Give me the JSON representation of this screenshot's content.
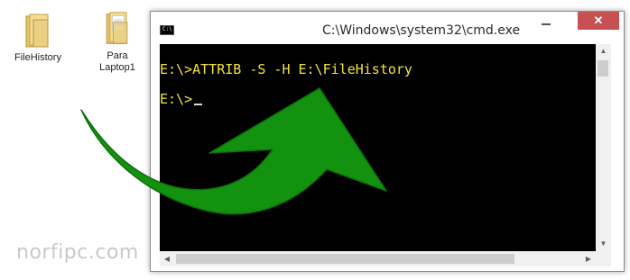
{
  "desktop": {
    "icons": [
      {
        "label": "FileHistory",
        "icon": "folder-icon"
      },
      {
        "label": "Para\nLaptop1",
        "icon": "folder-icon"
      }
    ]
  },
  "watermark": "norfipc.com",
  "window": {
    "title": "C:\\Windows\\system32\\cmd.exe",
    "app_icon_text": "C:\\",
    "close_label": "✕",
    "console_lines": [
      "E:\\>ATTRIB -S -H E:\\FileHistory",
      "E:\\>"
    ],
    "console_text_color": "#f2e33a",
    "console_bg": "#000000"
  },
  "annotation": {
    "arrow_color": "#13920f",
    "arrow_icon": "curved-arrow-icon"
  }
}
